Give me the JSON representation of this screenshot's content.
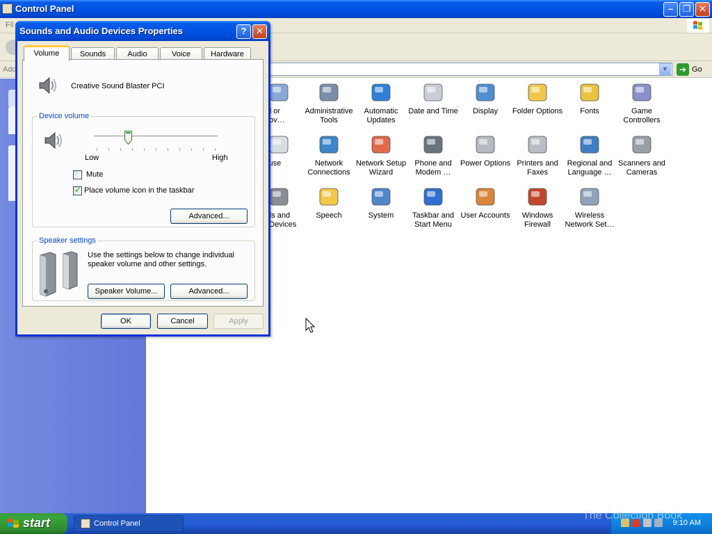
{
  "cp": {
    "title": "Control Panel",
    "menu_first": "Fil",
    "address_label": "Add",
    "go_label": "Go",
    "icons": [
      {
        "label": "dd or\nmov…",
        "col": 0,
        "row": 0,
        "icon": "add-remove-programs-icon",
        "partial": true
      },
      {
        "label": "Administrative\nTools",
        "col": 1,
        "row": 0,
        "icon": "administrative-tools-icon"
      },
      {
        "label": "Automatic\nUpdates",
        "col": 2,
        "row": 0,
        "icon": "automatic-updates-icon"
      },
      {
        "label": "Date and Time",
        "col": 3,
        "row": 0,
        "icon": "date-time-icon"
      },
      {
        "label": "Display",
        "col": 4,
        "row": 0,
        "icon": "display-icon"
      },
      {
        "label": "Folder Options",
        "col": 5,
        "row": 0,
        "icon": "folder-options-icon"
      },
      {
        "label": "Fonts",
        "col": 6,
        "row": 0,
        "icon": "fonts-icon"
      },
      {
        "label": "Game\nControllers",
        "col": 7,
        "row": 0,
        "icon": "game-controllers-icon"
      },
      {
        "label": "louse",
        "col": 0,
        "row": 1,
        "icon": "mouse-icon",
        "partial": true
      },
      {
        "label": "Network\nConnections",
        "col": 1,
        "row": 1,
        "icon": "network-connections-icon"
      },
      {
        "label": "Network Setup\nWizard",
        "col": 2,
        "row": 1,
        "icon": "network-setup-wizard-icon"
      },
      {
        "label": "Phone and\nModem …",
        "col": 3,
        "row": 1,
        "icon": "phone-modem-icon"
      },
      {
        "label": "Power Options",
        "col": 4,
        "row": 1,
        "icon": "power-options-icon"
      },
      {
        "label": "Printers and\nFaxes",
        "col": 5,
        "row": 1,
        "icon": "printers-faxes-icon"
      },
      {
        "label": "Regional and\nLanguage …",
        "col": 6,
        "row": 1,
        "icon": "regional-language-icon"
      },
      {
        "label": "Scanners and\nCameras",
        "col": 7,
        "row": 1,
        "icon": "scanners-cameras-icon"
      },
      {
        "label": "nds and\no Devices",
        "col": 0,
        "row": 2,
        "icon": "sounds-audio-icon",
        "partial": true,
        "selected": true
      },
      {
        "label": "Speech",
        "col": 1,
        "row": 2,
        "icon": "speech-icon"
      },
      {
        "label": "System",
        "col": 2,
        "row": 2,
        "icon": "system-icon"
      },
      {
        "label": "Taskbar and\nStart Menu",
        "col": 3,
        "row": 2,
        "icon": "taskbar-start-menu-icon"
      },
      {
        "label": "User Accounts",
        "col": 4,
        "row": 2,
        "icon": "user-accounts-icon"
      },
      {
        "label": "Windows\nFirewall",
        "col": 5,
        "row": 2,
        "icon": "windows-firewall-icon"
      },
      {
        "label": "Wireless\nNetwork Set…",
        "col": 6,
        "row": 2,
        "icon": "wireless-network-icon"
      }
    ]
  },
  "dialog": {
    "title": "Sounds and Audio Devices Properties",
    "help_glyph": "?",
    "close_glyph": "✕",
    "tabs": [
      "Volume",
      "Sounds",
      "Audio",
      "Voice",
      "Hardware"
    ],
    "active_tab": "Volume",
    "device_name": "Creative Sound Blaster PCI",
    "device_volume_title": "Device volume",
    "slider_low": "Low",
    "slider_high": "High",
    "slider_level": 0.27,
    "mute_label": "Mute",
    "mute_checked": false,
    "taskbar_icon_label": "Place volume icon in the taskbar",
    "taskbar_icon_checked": true,
    "advanced_label": "Advanced...",
    "speaker_settings_title": "Speaker settings",
    "speaker_text": "Use the settings below to change individual speaker volume and other settings.",
    "speaker_volume_label": "Speaker Volume...",
    "speaker_advanced_label": "Advanced...",
    "ok_label": "OK",
    "cancel_label": "Cancel",
    "apply_label": "Apply"
  },
  "taskbar": {
    "start_label": "start",
    "task_label": "Control Panel",
    "clock": "9:10 AM",
    "watermark": "The Collection Book"
  }
}
